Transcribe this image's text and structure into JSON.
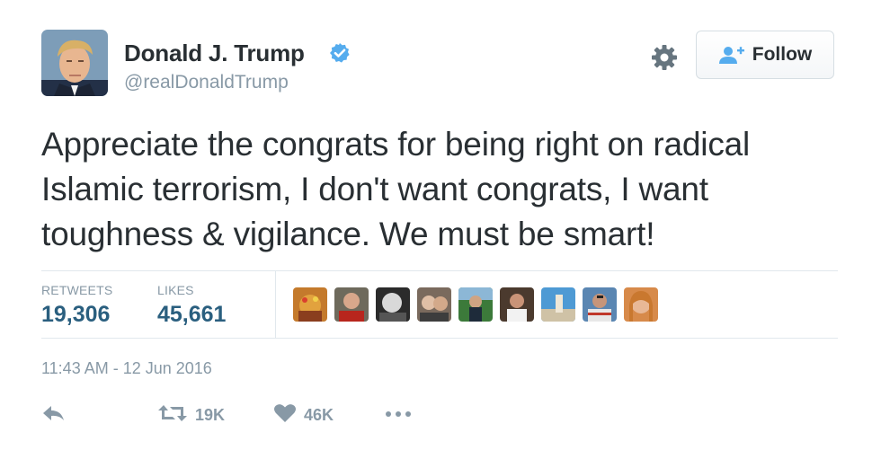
{
  "tweet": {
    "author": {
      "name": "Donald J. Trump",
      "handle": "@realDonaldTrump",
      "verified": true
    },
    "follow_label": "Follow",
    "text_lines": [
      "Appreciate the congrats for being right on radical",
      "Islamic terrorism, I don't want congrats, I want",
      "toughness & vigilance. We must be smart!"
    ],
    "stats": {
      "retweets_label": "RETWEETS",
      "retweets_value": "19,306",
      "likes_label": "LIKES",
      "likes_value": "45,661"
    },
    "liker_avatar_count": 9,
    "timestamp": "11:43 AM - 12 Jun 2016",
    "actions": {
      "reply_icon": "reply-icon",
      "retweet_icon": "retweet-icon",
      "retweet_count": "19K",
      "like_icon": "heart-icon",
      "like_count": "46K",
      "more_icon": "more-icon"
    }
  },
  "colors": {
    "text": "#292f33",
    "muted": "#8899a6",
    "stat_value": "#2a5f7f",
    "verified": "#55acee",
    "divider": "#e1e8ed"
  }
}
